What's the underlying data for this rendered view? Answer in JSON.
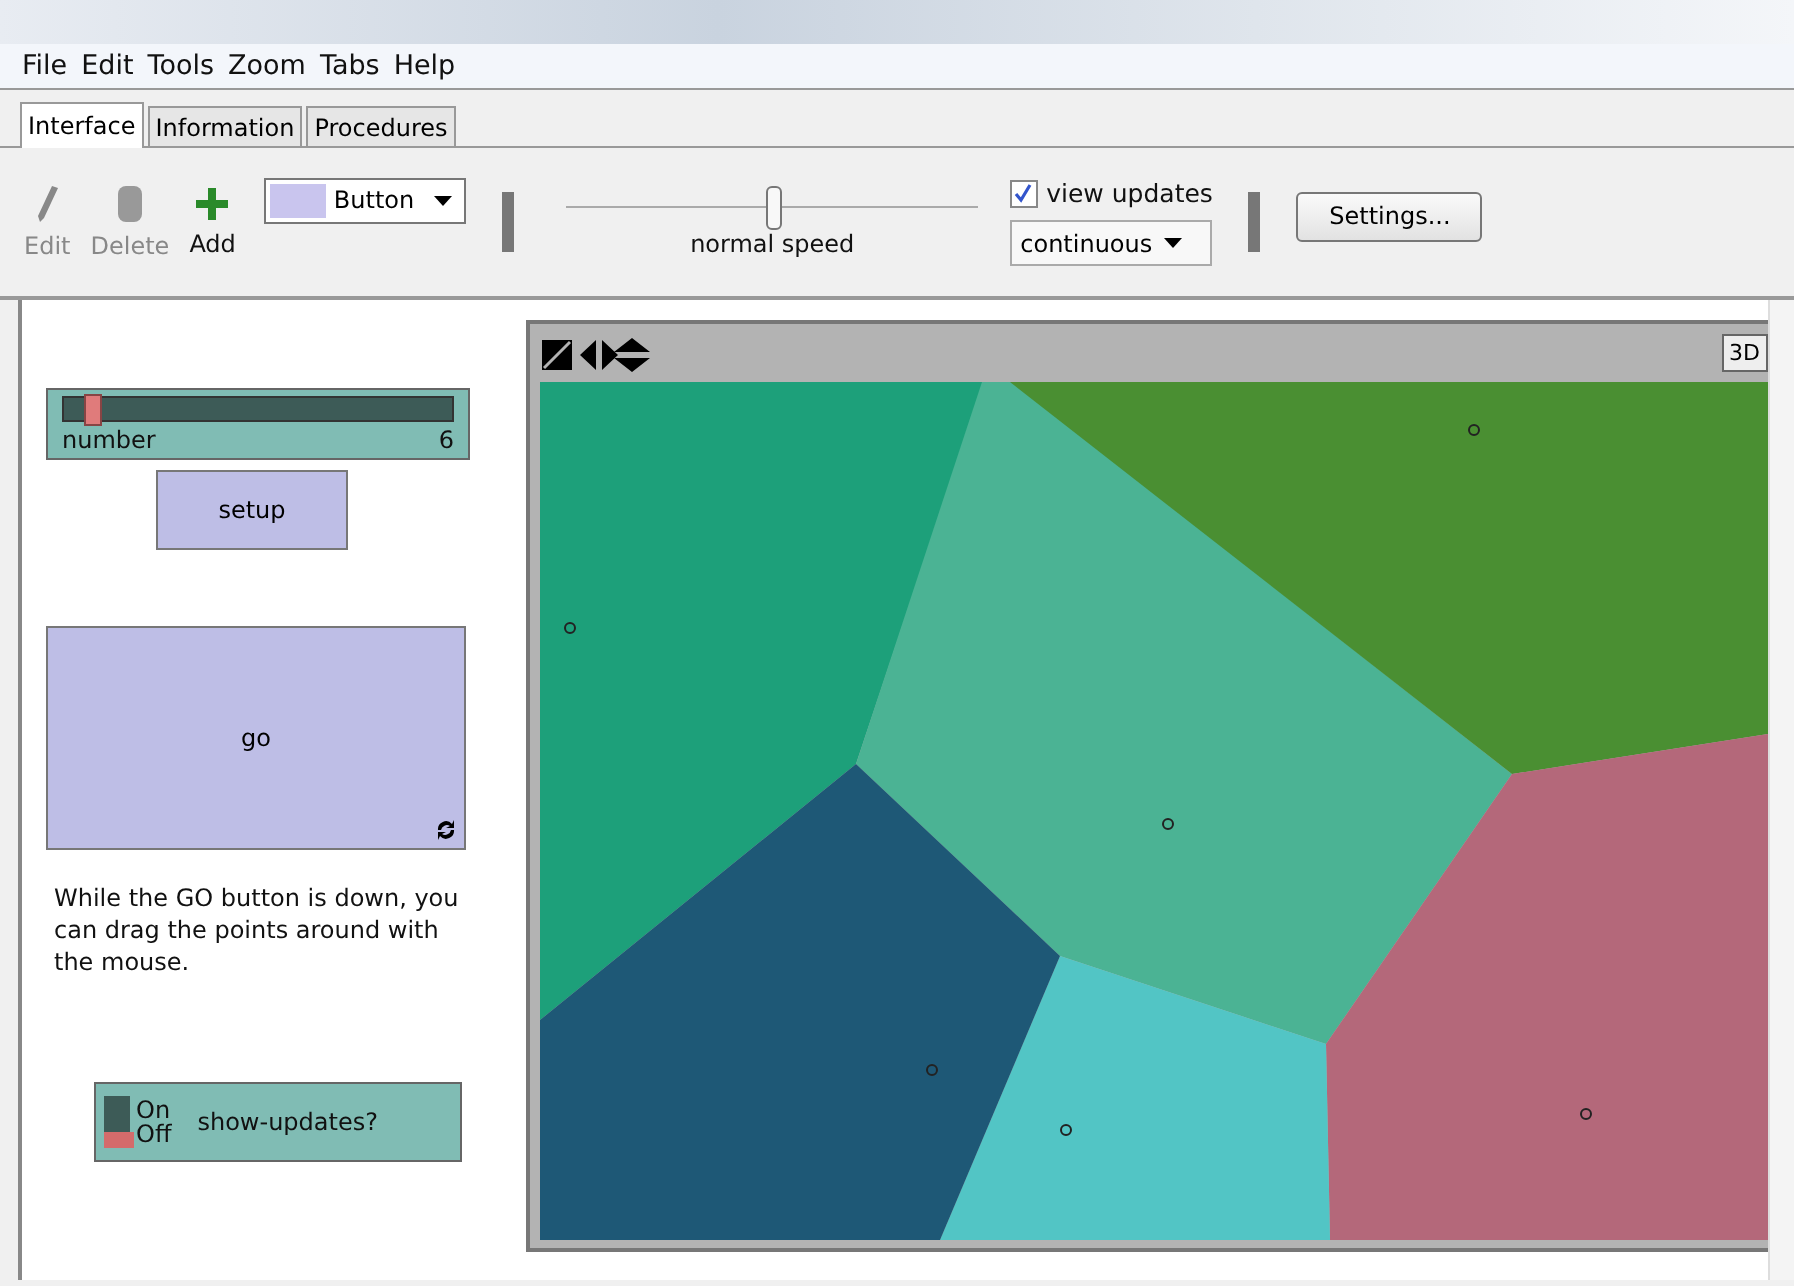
{
  "menu": [
    "File",
    "Edit",
    "Tools",
    "Zoom",
    "Tabs",
    "Help"
  ],
  "tabs": [
    {
      "label": "Interface",
      "selected": true
    },
    {
      "label": "Information",
      "selected": false
    },
    {
      "label": "Procedures",
      "selected": false
    }
  ],
  "toolbar": {
    "tools": [
      {
        "label": "Edit",
        "disabled": true,
        "kind": "pencil"
      },
      {
        "label": "Delete",
        "disabled": true,
        "kind": "trash"
      },
      {
        "label": "Add",
        "disabled": false,
        "kind": "plus"
      }
    ],
    "widget_type": "Button",
    "speed": {
      "label": "normal speed",
      "level": 0.5
    },
    "view_updates": {
      "label": "view updates",
      "checked": true
    },
    "update_mode": "continuous",
    "settings": "Settings..."
  },
  "widgets": [
    {
      "kind": "slider",
      "label": "number",
      "value": "6",
      "level": 0.05
    },
    {
      "kind": "button",
      "label": "setup",
      "forever": false
    },
    {
      "kind": "button",
      "label": "go",
      "forever": true
    },
    {
      "kind": "note",
      "text": "While the GO button is down, you can drag the points around with the mouse."
    },
    {
      "kind": "switch",
      "label": "show-updates?",
      "on_label": "On",
      "off_label": "Off",
      "on": false
    }
  ],
  "view": {
    "button_3d": "3D"
  }
}
